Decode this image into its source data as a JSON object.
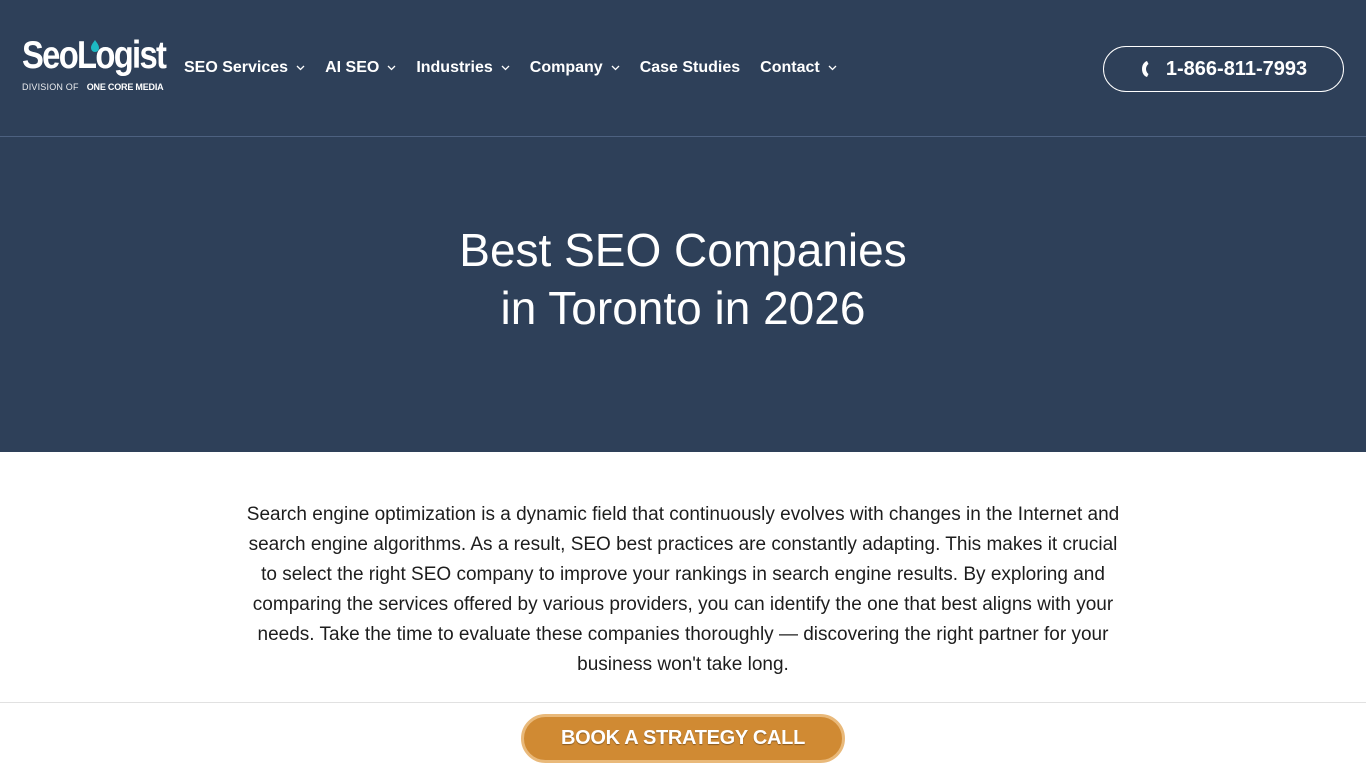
{
  "logo": {
    "name_part1": "SeoL",
    "name_part2": "gist",
    "division_prefix": "DIVISION OF",
    "division_brand": "ONE CORE MEDIA",
    "drop_color": "#1db9c3",
    "ring_color": "#e0447a"
  },
  "nav": {
    "items": [
      {
        "label": "SEO Services",
        "has_dropdown": true,
        "icon": "chevron-down-icon"
      },
      {
        "label": "AI SEO",
        "has_dropdown": true,
        "icon": "chevron-down-icon"
      },
      {
        "label": "Industries",
        "has_dropdown": true,
        "icon": "chevron-down-icon"
      },
      {
        "label": "Company",
        "has_dropdown": true,
        "icon": "chevron-down-icon"
      },
      {
        "label": "Case Studies",
        "has_dropdown": false
      },
      {
        "label": "Contact",
        "has_dropdown": true,
        "icon": "chevron-down-icon"
      }
    ]
  },
  "phone": {
    "number": "1-866-811-7993",
    "icon": "phone-icon"
  },
  "hero": {
    "title_line1": "Best SEO Companies",
    "title_line2": "in Toronto in 2026"
  },
  "intro": {
    "text": "Search engine optimization is a dynamic field that continuously evolves with changes in the Internet and search engine algorithms. As a result, SEO best practices are constantly adapting. This makes it crucial to select the right SEO company to improve your rankings in search engine results. By exploring and comparing the services offered by various providers, you can identify the one that best aligns with your needs. Take the time to evaluate these companies thoroughly — discovering the right partner for your business won't take long."
  },
  "cta": {
    "label": "BOOK A STRATEGY CALL"
  },
  "colors": {
    "header_bg": "#2e4059",
    "cta_bg": "#d08a33",
    "cta_border": "#e9b97a",
    "body_text": "#1d1d1d"
  }
}
